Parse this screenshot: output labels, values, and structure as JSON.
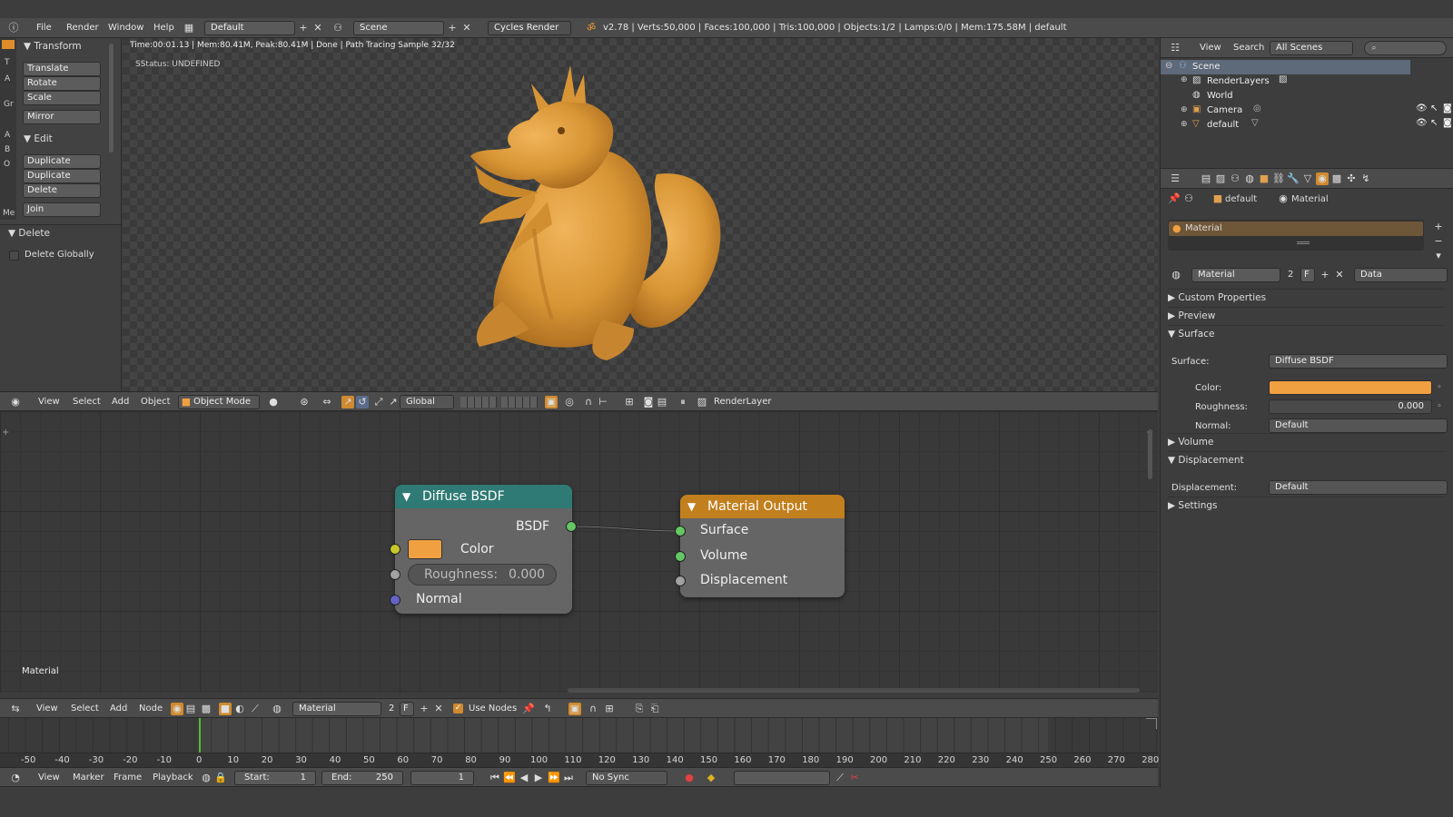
{
  "topbar": {
    "menus": [
      "File",
      "Render",
      "Window",
      "Help"
    ],
    "layout": "Default",
    "scene": "Scene",
    "engine": "Cycles Render",
    "stats": "v2.78 | Verts:50,000 | Faces:100,000 | Tris:100,000 | Objects:1/2 | Lamps:0/0 | Mem:175.58M | default"
  },
  "toolshelf": {
    "tabs": [
      "T",
      "A",
      "Gr",
      "A",
      "B",
      "O",
      "Me"
    ],
    "transform_title": "Transform",
    "transform_buttons": [
      "Translate",
      "Rotate",
      "Scale"
    ],
    "mirror": "Mirror",
    "edit_title": "Edit",
    "edit_buttons": [
      "Duplicate",
      "Duplicate Linked",
      "Delete"
    ],
    "join": "Join",
    "delete_title": "Delete",
    "delete_globally": "Delete Globally"
  },
  "viewport": {
    "render_status": "Time:00:01.13 | Mem:80.41M, Peak:80.41M | Done | Path Tracing Sample 32/32",
    "sstatus": "SStatus: UNDEFINED"
  },
  "view3d_header": {
    "menus": [
      "View",
      "Select",
      "Add",
      "Object"
    ],
    "mode": "Object Mode",
    "orientation": "Global",
    "render_layer": "RenderLayer"
  },
  "node_editor": {
    "diffuse": {
      "title": "Diffuse BSDF",
      "output": "BSDF",
      "color_label": "Color",
      "roughness_label": "Roughness:",
      "roughness_value": "0.000",
      "normal_label": "Normal"
    },
    "output_node": {
      "title": "Material Output",
      "surface": "Surface",
      "volume": "Volume",
      "displacement": "Displacement"
    },
    "context_label": "Material",
    "colors": {
      "diffuse_header": "#2f7a74",
      "output_header": "#c27f1d",
      "color_swatch": "#f0a040"
    }
  },
  "node_header": {
    "menus": [
      "View",
      "Select",
      "Add",
      "Node"
    ],
    "material": "Material",
    "users": "2",
    "fake": "F",
    "use_nodes": "Use Nodes"
  },
  "timeline": {
    "ticks": [
      "-50",
      "-40",
      "-30",
      "-20",
      "-10",
      "0",
      "10",
      "20",
      "30",
      "40",
      "50",
      "60",
      "70",
      "80",
      "90",
      "100",
      "110",
      "120",
      "130",
      "140",
      "150",
      "160",
      "170",
      "180",
      "190",
      "200",
      "210",
      "220",
      "230",
      "240",
      "250",
      "260",
      "270",
      "280"
    ],
    "menus": [
      "View",
      "Marker",
      "Frame",
      "Playback"
    ],
    "start_label": "Start:",
    "start": "1",
    "end_label": "End:",
    "end": "250",
    "current": "1",
    "sync": "No Sync"
  },
  "outliner": {
    "menus": [
      "View",
      "Search"
    ],
    "filter": "All Scenes",
    "items": [
      "Scene",
      "RenderLayers",
      "World",
      "Camera",
      "default"
    ]
  },
  "properties": {
    "breadcrumb_object": "default",
    "breadcrumb_material": "Material",
    "slot": "Material",
    "material_name": "Material",
    "users": "2",
    "fake": "F",
    "link": "Data",
    "panels": {
      "custom": "Custom Properties",
      "preview": "Preview",
      "surface": "Surface",
      "volume": "Volume",
      "displacement": "Displacement",
      "settings": "Settings"
    },
    "surface_label": "Surface:",
    "surface_value": "Diffuse BSDF",
    "color_label": "Color:",
    "roughness_label": "Roughness:",
    "roughness_value": "0.000",
    "normal_label": "Normal:",
    "normal_value": "Default",
    "displacement_label": "Displacement:",
    "displacement_value": "Default"
  }
}
